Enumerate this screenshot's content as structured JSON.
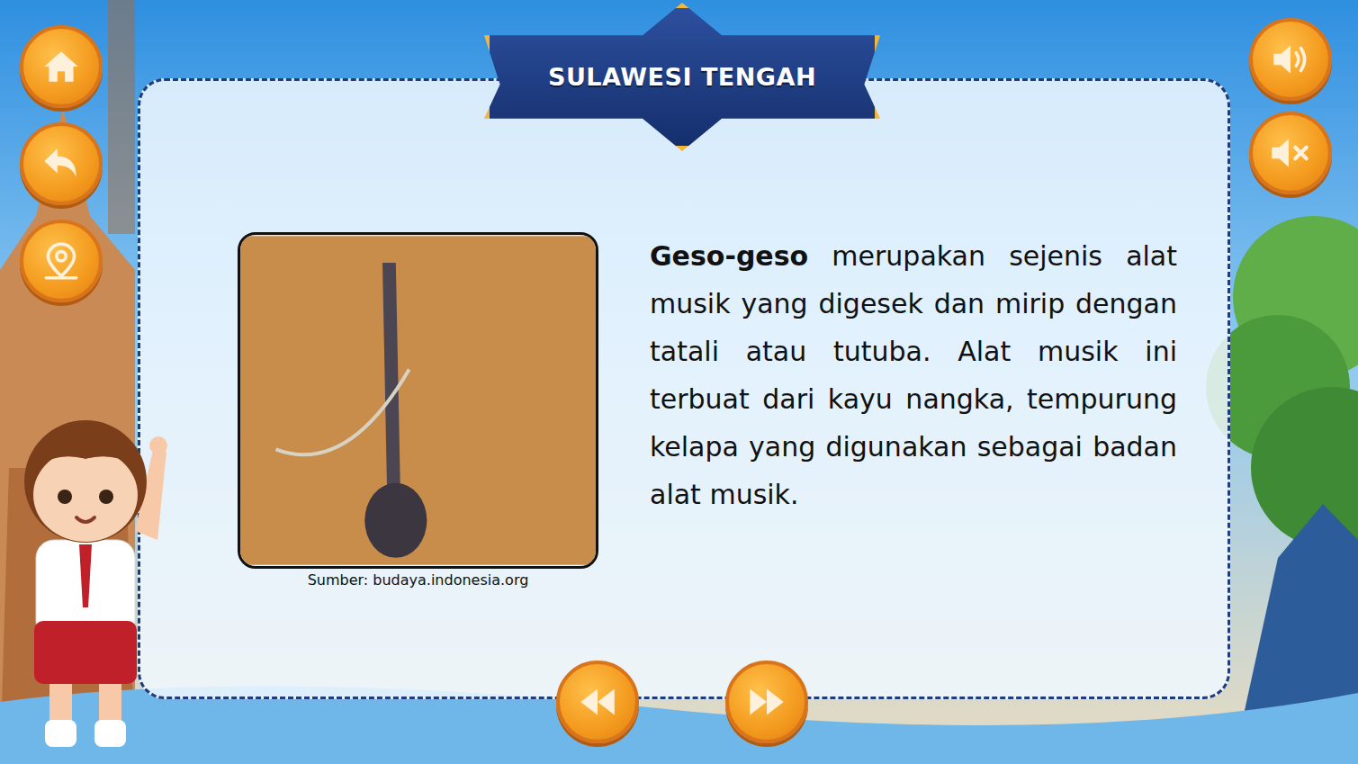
{
  "header": {
    "title": "SULAWESI TENGAH"
  },
  "photo": {
    "caption": "Sumber: budaya.indonesia.org"
  },
  "description": {
    "term": "Geso-geso",
    "text": " merupakan sejenis alat musik yang digesek dan mirip dengan tatali atau tutuba. Alat musik ini terbuat dari kayu nangka, tempurung kelapa yang digunakan sebagai badan alat musik."
  }
}
